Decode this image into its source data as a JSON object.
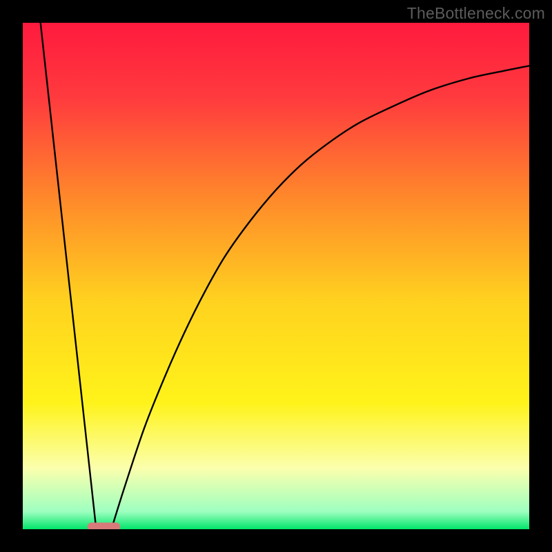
{
  "watermark": "TheBottleneck.com",
  "chart_data": {
    "type": "line",
    "title": "",
    "xlabel": "",
    "ylabel": "",
    "xlim": [
      0,
      100
    ],
    "ylim": [
      0,
      100
    ],
    "grid": false,
    "legend": false,
    "background_gradient": {
      "stops": [
        {
          "offset": 0.0,
          "color": "#ff1a3e"
        },
        {
          "offset": 0.15,
          "color": "#ff3b3e"
        },
        {
          "offset": 0.35,
          "color": "#ff8a2a"
        },
        {
          "offset": 0.55,
          "color": "#ffd21f"
        },
        {
          "offset": 0.75,
          "color": "#fff31a"
        },
        {
          "offset": 0.88,
          "color": "#fbffad"
        },
        {
          "offset": 0.965,
          "color": "#9effc0"
        },
        {
          "offset": 1.0,
          "color": "#00e66a"
        }
      ]
    },
    "series": [
      {
        "name": "left-branch",
        "x": [
          3.5,
          14.5
        ],
        "y": [
          100,
          0
        ]
      },
      {
        "name": "right-branch",
        "x": [
          17.5,
          20,
          24,
          28,
          32,
          36,
          40,
          45,
          50,
          55,
          60,
          66,
          72,
          80,
          88,
          95,
          100
        ],
        "y": [
          0,
          8,
          20,
          30,
          39,
          47,
          54,
          61,
          67,
          72,
          76,
          80,
          83,
          86.5,
          89,
          90.5,
          91.5
        ]
      }
    ],
    "marker": {
      "name": "bottom-pill",
      "x_center": 16,
      "width": 6.5,
      "y": 0.5,
      "color": "#d87a7a"
    }
  }
}
